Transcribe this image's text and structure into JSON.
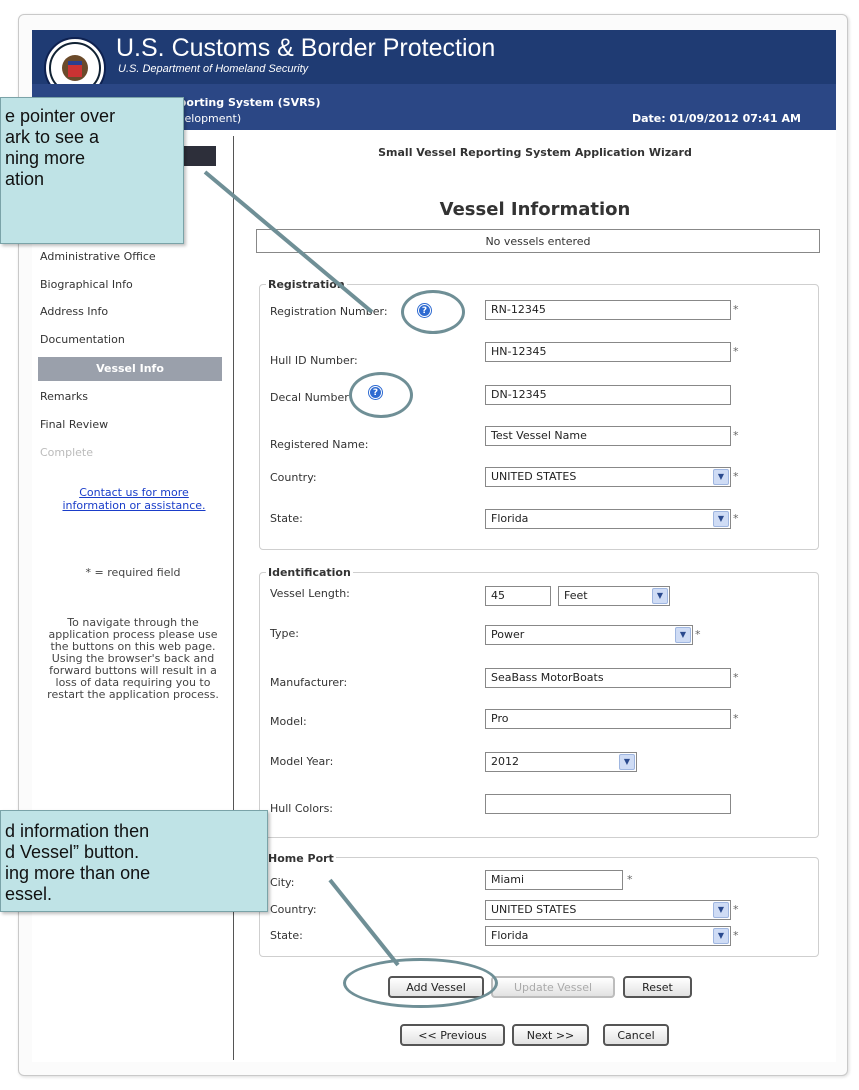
{
  "header": {
    "agency": "U.S. Customs & Border Protection",
    "department": "U.S. Department of Homeland Security",
    "system_name": "essel Reporting System (SVRS)",
    "version": "1.7.5 (Development)",
    "date": "Date: 01/09/2012 07:41 AM"
  },
  "sidebar": {
    "items": [
      {
        "label": "Administrative Office",
        "state": "done"
      },
      {
        "label": "Biographical Info",
        "state": "done"
      },
      {
        "label": "Address Info",
        "state": "done"
      },
      {
        "label": "Documentation",
        "state": "done"
      },
      {
        "label": "Vessel Info",
        "state": "active"
      },
      {
        "label": "Remarks",
        "state": "done"
      },
      {
        "label": "Final Review",
        "state": "done"
      },
      {
        "label": "Complete",
        "state": "disabled"
      }
    ],
    "contact_link": "Contact us for more information or assistance.",
    "required_note": "* = required field",
    "help_text": "To navigate through the application process please use the buttons on this web page. Using the browser's back and forward buttons will result in a loss of data requiring you to restart the application process."
  },
  "main": {
    "wizard_title": "Small Vessel Reporting System Application Wizard",
    "section_title": "Vessel Information",
    "vessel_list_status": "No vessels entered",
    "registration": {
      "legend": "Registration",
      "registration_number_label": "Registration Number:",
      "registration_number_value": "RN-12345",
      "hull_id_label": "Hull ID Number:",
      "hull_id_value": "HN-12345",
      "decal_label": "Decal Number:",
      "decal_value": "DN-12345",
      "registered_name_label": "Registered Name:",
      "registered_name_value": "Test Vessel Name",
      "country_label": "Country:",
      "country_value": "UNITED STATES",
      "state_label": "State:",
      "state_value": "Florida"
    },
    "identification": {
      "legend": "Identification",
      "length_label": "Vessel Length:",
      "length_value": "45",
      "length_unit": "Feet",
      "type_label": "Type:",
      "type_value": "Power",
      "manufacturer_label": "Manufacturer:",
      "manufacturer_value": "SeaBass MotorBoats",
      "model_label": "Model:",
      "model_value": "Pro",
      "model_year_label": "Model Year:",
      "model_year_value": "2012",
      "hull_colors_label": "Hull Colors:",
      "hull_colors_value": ""
    },
    "home_port": {
      "legend": "Home Port",
      "city_label": "City:",
      "city_value": "Miami",
      "country_label": "Country:",
      "country_value": "UNITED STATES",
      "state_label": "State:",
      "state_value": "Florida"
    },
    "buttons": {
      "add_vessel": "Add Vessel",
      "update_vessel": "Update Vessel",
      "reset": "Reset",
      "previous": "<< Previous",
      "next": "Next >>",
      "cancel": "Cancel"
    },
    "required_marker": "*"
  },
  "callouts": {
    "help_tip": [
      "e pointer over",
      "ark to see a",
      "ning more",
      "ation"
    ],
    "add_tip": [
      "d information then",
      "d Vessel” button.",
      "ing more than one",
      "essel."
    ]
  },
  "colors": {
    "banner": "#1f3b73",
    "subbar": "#2b4785",
    "callout": "#bfe3e6",
    "nav_active": "#9aa0ab",
    "link": "#1a3dc9"
  }
}
